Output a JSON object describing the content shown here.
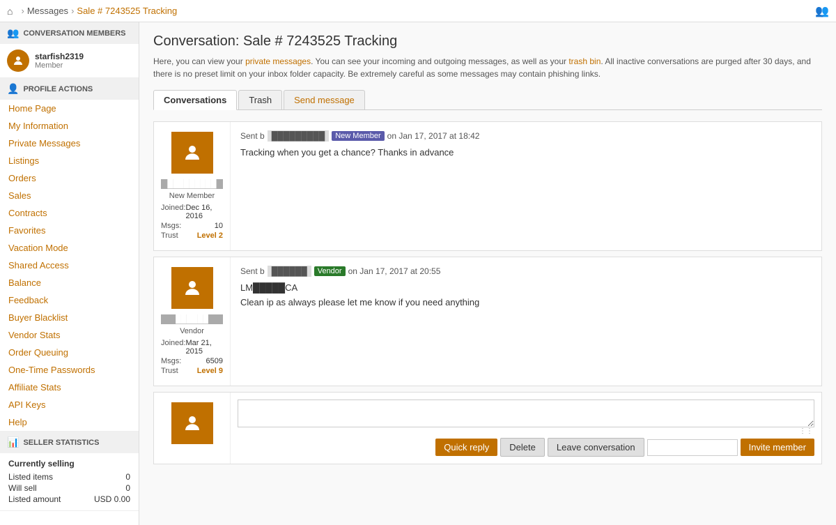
{
  "topnav": {
    "home_icon": "⌂",
    "breadcrumb": [
      {
        "label": "Messages",
        "href": "#"
      },
      {
        "label": "Sale # 7243525 Tracking",
        "active": true
      }
    ],
    "profile_icon": "👤"
  },
  "sidebar": {
    "conversation_members": {
      "header": "CONVERSATION MEMBERS",
      "header_icon": "👥",
      "user": {
        "name": "starfish2319",
        "role": "Member"
      }
    },
    "profile_actions": {
      "header": "PROFILE ACTIONS",
      "header_icon": "👤",
      "links": [
        "Home Page",
        "My Information",
        "Private Messages",
        "Listings",
        "Orders",
        "Sales",
        "Contracts",
        "Favorites",
        "Vacation Mode",
        "Shared Access",
        "Balance",
        "Feedback",
        "Buyer Blacklist",
        "Vendor Stats",
        "Order Queuing",
        "One-Time Passwords",
        "Affiliate Stats",
        "API Keys",
        "Help"
      ]
    },
    "seller_statistics": {
      "header": "SELLER STATISTICS",
      "header_icon": "📊",
      "currently_selling": "Currently selling",
      "stats": [
        {
          "label": "Listed items",
          "value": "0"
        },
        {
          "label": "Will sell",
          "value": "0"
        },
        {
          "label": "Listed amount",
          "value": "USD 0.00"
        }
      ]
    }
  },
  "main": {
    "title": "Conversation: Sale # 7243525 Tracking",
    "info_text": "Here, you can view your private messages. You can see your incoming and outgoing messages, as well as your trash bin. All inactive conversations are purged after 30 days, and there is no preset limit on your inbox folder capacity. Be extremely careful as some messages may contain phishing links.",
    "tabs": [
      {
        "label": "Conversations",
        "active": true
      },
      {
        "label": "Trash",
        "active": false
      },
      {
        "label": "Send message",
        "active": false,
        "special": true
      }
    ],
    "messages": [
      {
        "avatar_username": "█████████",
        "member_label": "New Member",
        "joined": "Dec 16, 2016",
        "msgs": "10",
        "trust": "Level 2",
        "sender_display": "█████████",
        "badge": "New Member",
        "badge_type": "new_member",
        "timestamp": "on Jan 17, 2017 at 18:42",
        "sent_prefix": "Sent b",
        "body": "Tracking when you get a chance? Thanks in advance"
      },
      {
        "avatar_username": "██████",
        "member_label": "Vendor",
        "joined": "Mar 21, 2015",
        "msgs": "6509",
        "trust": "Level 9",
        "sender_display": "██████",
        "badge": "Vendor",
        "badge_type": "vendor",
        "timestamp": "on Jan 17, 2017 at 20:55",
        "sent_prefix": "Sent b",
        "sub_text": "LM█████CA",
        "body": "Clean ip as always please let me know if you need anything"
      }
    ],
    "reply": {
      "placeholder": "",
      "buttons": {
        "quick_reply": "Quick reply",
        "delete": "Delete",
        "leave_conversation": "Leave conversation",
        "invite_placeholder": "",
        "invite_member": "Invite member"
      }
    }
  }
}
